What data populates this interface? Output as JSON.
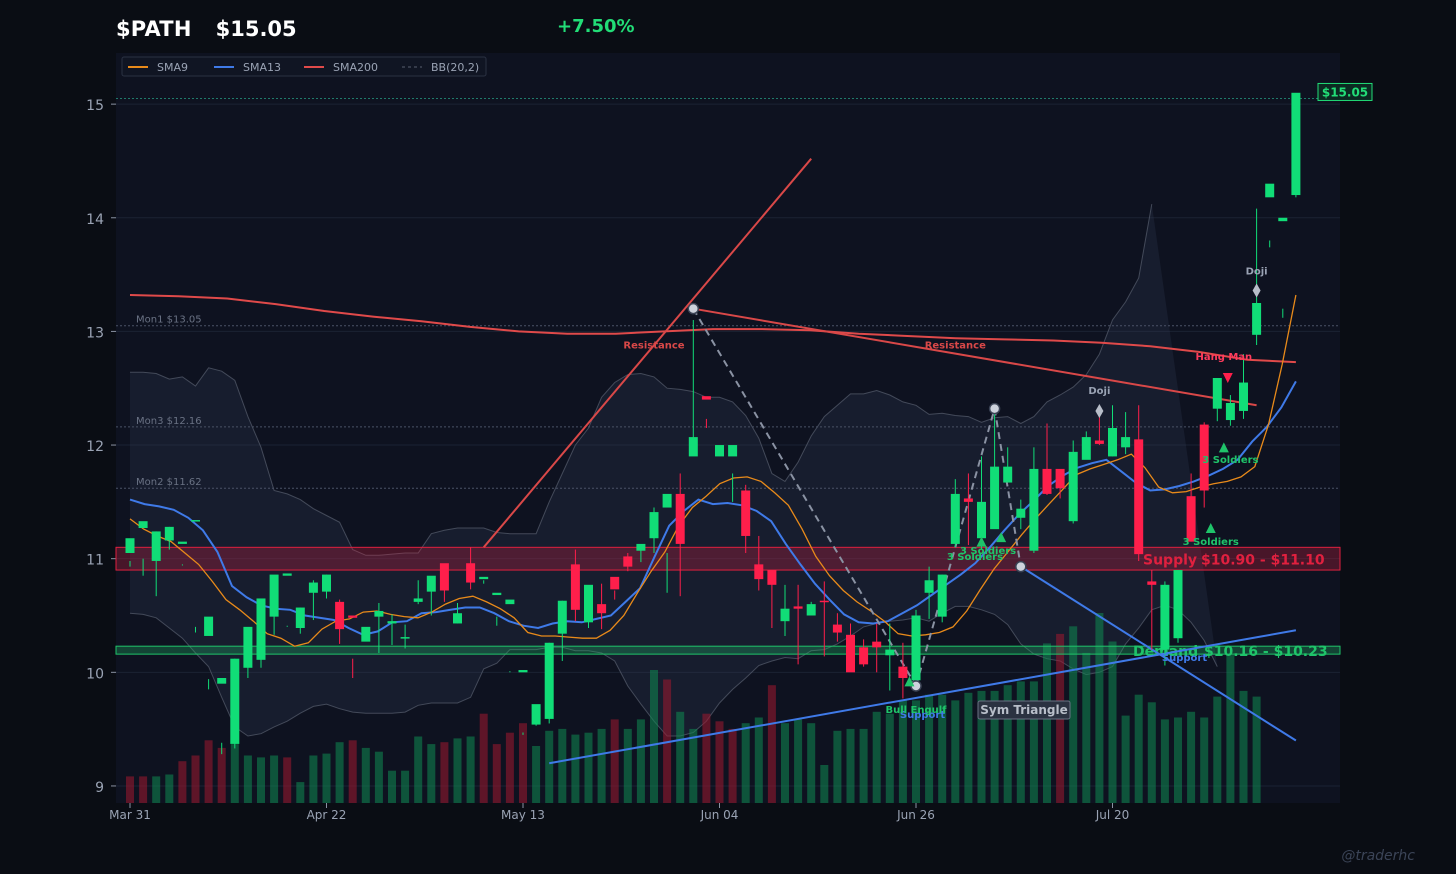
{
  "header": {
    "ticker": "$PATH",
    "price": "$15.05",
    "change": "+7.50%"
  },
  "watermark": "@traderhc",
  "colors": {
    "background": "#0a0d14",
    "plot_bg": "#0e1220",
    "up": "#11dd77",
    "down": "#ff1f4b",
    "sma9": "#e88a1a",
    "sma13": "#3f7ae8",
    "sma200": "#e04a4a",
    "bb": "#59606f",
    "supply": "#e0203f",
    "demand": "#1fc46a",
    "support_line": "#3f7ae8",
    "resistance_line": "#d94848"
  },
  "chart_data": {
    "type": "candlestick",
    "ylim": [
      8.85,
      15.45
    ],
    "yticks": [
      9,
      10,
      11,
      12,
      13,
      14,
      15
    ],
    "xticks": [
      {
        "label": "Mar 31",
        "index": 0
      },
      {
        "label": "Apr 22",
        "index": 15
      },
      {
        "label": "May 13",
        "index": 30
      },
      {
        "label": "Jun 04",
        "index": 45
      },
      {
        "label": "Jun 26",
        "index": 60
      },
      {
        "label": "Jul 20",
        "index": 75
      }
    ],
    "legend": [
      {
        "name": "SMA9",
        "color": "#e88a1a",
        "style": "solid"
      },
      {
        "name": "SMA13",
        "color": "#3f7ae8",
        "style": "solid"
      },
      {
        "name": "SMA200",
        "color": "#e04a4a",
        "style": "solid"
      },
      {
        "name": "BB(20,2)",
        "color": "#59606f",
        "style": "dashed"
      }
    ],
    "candles": [
      [
        11.05,
        11.18,
        10.93,
        10.98
      ],
      [
        11.27,
        11.33,
        10.85,
        11.0
      ],
      [
        10.98,
        11.24,
        10.67,
        11.24
      ],
      [
        11.16,
        11.28,
        11.08,
        11.28
      ],
      [
        11.13,
        11.15,
        10.94,
        10.95
      ],
      [
        11.33,
        11.34,
        10.35,
        10.4
      ],
      [
        10.32,
        10.49,
        9.85,
        9.94
      ],
      [
        9.9,
        9.95,
        9.28,
        9.38
      ],
      [
        9.37,
        10.12,
        9.33,
        10.12
      ],
      [
        10.04,
        10.4,
        9.95,
        10.31
      ],
      [
        10.11,
        10.65,
        10.04,
        10.62
      ],
      [
        10.49,
        10.86,
        10.33,
        10.76
      ],
      [
        10.85,
        10.87,
        10.4,
        10.41
      ],
      [
        10.39,
        10.57,
        10.34,
        10.57
      ],
      [
        10.7,
        10.79,
        10.46,
        10.81
      ],
      [
        10.71,
        10.86,
        10.65,
        10.86
      ],
      [
        10.62,
        10.38,
        10.25,
        10.64
      ],
      [
        10.5,
        10.48,
        9.95,
        10.12
      ],
      [
        10.27,
        10.4,
        10.29,
        10.37
      ],
      [
        10.49,
        10.54,
        10.17,
        10.61
      ],
      [
        10.43,
        10.45,
        10.24,
        10.51
      ],
      [
        10.3,
        10.31,
        10.21,
        10.42
      ],
      [
        10.62,
        10.65,
        10.6,
        10.81
      ],
      [
        10.71,
        10.85,
        10.5,
        10.84
      ],
      [
        10.96,
        10.72,
        10.62,
        10.89
      ],
      [
        10.43,
        10.52,
        10.43,
        10.61
      ],
      [
        10.96,
        10.79,
        10.73,
        11.1
      ],
      [
        10.82,
        10.84,
        10.81,
        10.78
      ],
      [
        10.68,
        10.7,
        10.41,
        10.49
      ],
      [
        10.6,
        10.64,
        10.0,
        10.01
      ],
      [
        10.0,
        10.02,
        9.45,
        9.47
      ],
      [
        9.54,
        9.72,
        9.53,
        9.68
      ],
      [
        9.59,
        10.26,
        9.55,
        10.26
      ],
      [
        10.34,
        10.63,
        10.1,
        10.63
      ],
      [
        10.95,
        10.55,
        10.45,
        11.08
      ],
      [
        10.44,
        10.77,
        10.39,
        10.76
      ],
      [
        10.6,
        10.52,
        10.38,
        10.78
      ],
      [
        10.84,
        10.73,
        10.64,
        10.72
      ],
      [
        11.02,
        10.93,
        10.89,
        11.05
      ],
      [
        11.07,
        11.13,
        10.97,
        11.12
      ],
      [
        11.18,
        11.41,
        11.05,
        11.45
      ],
      [
        11.45,
        11.57,
        11.05,
        10.7
      ],
      [
        11.57,
        11.13,
        10.67,
        11.75
      ],
      [
        11.9,
        12.07,
        11.97,
        13.1
      ],
      [
        12.43,
        12.4,
        12.23,
        12.15
      ],
      [
        11.9,
        12.0,
        11.6,
        11.6
      ],
      [
        11.9,
        12.0,
        11.5,
        11.75
      ],
      [
        11.6,
        11.2,
        11.05,
        11.65
      ],
      [
        10.95,
        10.82,
        10.72,
        11.2
      ],
      [
        10.9,
        10.77,
        10.39,
        10.85
      ],
      [
        10.45,
        10.56,
        10.32,
        10.77
      ],
      [
        10.58,
        10.56,
        10.07,
        10.77
      ],
      [
        10.5,
        10.6,
        10.5,
        10.62
      ],
      [
        10.63,
        10.62,
        10.14,
        10.8
      ],
      [
        10.42,
        10.35,
        10.27,
        10.52
      ],
      [
        10.33,
        10.0,
        10.03,
        10.43
      ],
      [
        10.22,
        10.07,
        10.05,
        10.29
      ],
      [
        10.27,
        10.22,
        10.0,
        10.43
      ],
      [
        10.15,
        10.2,
        9.84,
        10.43
      ],
      [
        10.05,
        9.95,
        9.77,
        10.26
      ],
      [
        9.93,
        10.5,
        9.87,
        10.55
      ],
      [
        10.7,
        10.81,
        10.47,
        10.93
      ],
      [
        10.49,
        10.86,
        10.44,
        10.86
      ],
      [
        11.13,
        11.57,
        11.1,
        11.7
      ],
      [
        11.53,
        11.5,
        11.12,
        11.75
      ],
      [
        11.18,
        11.5,
        11.08,
        11.9
      ],
      [
        11.26,
        11.81,
        11.38,
        12.3
      ],
      [
        11.67,
        11.81,
        11.78,
        11.98
      ],
      [
        11.36,
        11.44,
        11.26,
        11.52
      ],
      [
        11.07,
        11.79,
        11.05,
        11.98
      ],
      [
        11.79,
        11.57,
        11.56,
        12.19
      ],
      [
        11.79,
        11.62,
        11.53,
        11.77
      ],
      [
        11.33,
        11.94,
        11.31,
        12.04
      ],
      [
        11.87,
        12.07,
        11.97,
        12.12
      ],
      [
        12.04,
        12.01,
        12.0,
        12.34
      ],
      [
        11.9,
        12.15,
        11.9,
        12.35
      ],
      [
        11.98,
        12.07,
        11.92,
        12.29
      ],
      [
        12.05,
        11.04,
        10.98,
        12.35
      ],
      [
        10.8,
        10.77,
        10.2,
        10.9
      ],
      [
        10.2,
        10.77,
        10.06,
        10.8
      ],
      [
        10.3,
        10.9,
        10.26,
        10.9
      ],
      [
        11.55,
        11.15,
        11.15,
        11.75
      ],
      [
        12.18,
        11.6,
        11.45,
        12.2
      ],
      [
        12.32,
        12.59,
        12.21,
        12.42
      ],
      [
        12.22,
        12.37,
        12.17,
        12.44
      ],
      [
        12.3,
        12.55,
        12.23,
        12.8
      ],
      [
        12.97,
        13.25,
        12.88,
        14.08
      ],
      [
        14.18,
        14.3,
        13.8,
        13.74
      ],
      [
        13.97,
        14.0,
        13.2,
        13.12
      ],
      [
        14.2,
        15.1,
        14.18,
        15.05
      ]
    ],
    "overlays": {
      "sma9": [
        11.35,
        11.26,
        11.2,
        11.15,
        11.05,
        10.95,
        10.8,
        10.64,
        10.55,
        10.45,
        10.34,
        10.3,
        10.23,
        10.26,
        10.38,
        10.45,
        10.47,
        10.53,
        10.54,
        10.51,
        10.49,
        10.48,
        10.53,
        10.6,
        10.65,
        10.67,
        10.62,
        10.56,
        10.48,
        10.35,
        10.32,
        10.32,
        10.31,
        10.3,
        10.3,
        10.37,
        10.5,
        10.7,
        10.89,
        11.06,
        11.29,
        11.45,
        11.55,
        11.66,
        11.71,
        11.72,
        11.68,
        11.58,
        11.47,
        11.26,
        11.02,
        10.85,
        10.72,
        10.62,
        10.54,
        10.45,
        10.34,
        10.32,
        10.33,
        10.35,
        10.4,
        10.54,
        10.73,
        10.91,
        11.06,
        11.21,
        11.35,
        11.48,
        11.61,
        11.74,
        11.79,
        11.83,
        11.87,
        11.92,
        11.8,
        11.63,
        11.58,
        11.59,
        11.63,
        11.66,
        11.68,
        11.72,
        11.81,
        12.18,
        12.71,
        13.32
      ],
      "sma13": [
        11.52,
        11.48,
        11.46,
        11.43,
        11.36,
        11.25,
        11.06,
        10.76,
        10.66,
        10.59,
        10.56,
        10.55,
        10.5,
        10.48,
        10.46,
        10.39,
        10.33,
        10.36,
        10.44,
        10.45,
        10.52,
        10.53,
        10.55,
        10.57,
        10.57,
        10.52,
        10.45,
        10.41,
        10.39,
        10.43,
        10.45,
        10.44,
        10.47,
        10.5,
        10.62,
        10.74,
        11.02,
        11.29,
        11.42,
        11.52,
        11.48,
        11.49,
        11.47,
        11.42,
        11.33,
        11.13,
        10.95,
        10.78,
        10.64,
        10.51,
        10.44,
        10.43,
        10.45,
        10.52,
        10.59,
        10.68,
        10.77,
        10.86,
        10.96,
        11.1,
        11.25,
        11.39,
        11.51,
        11.64,
        11.73,
        11.8,
        11.84,
        11.87,
        11.77,
        11.67,
        11.6,
        11.61,
        11.64,
        11.68,
        11.73,
        11.79,
        11.87,
        12.03,
        12.16,
        12.33,
        12.56
      ],
      "sma200": [
        13.32,
        13.31,
        13.29,
        13.24,
        13.18,
        13.13,
        13.09,
        13.04,
        13.0,
        12.98,
        12.98,
        13.0,
        13.02,
        13.02,
        13.01,
        12.98,
        12.96,
        12.94,
        12.93,
        12.92,
        12.9,
        12.87,
        12.82,
        12.75,
        12.73
      ],
      "bb_upper": [
        12.64,
        12.64,
        12.63,
        12.58,
        12.6,
        12.52,
        12.68,
        12.65,
        12.57,
        12.25,
        11.98,
        11.6,
        11.57,
        11.52,
        11.44,
        11.38,
        11.32,
        11.08,
        11.03,
        11.03,
        11.04,
        11.05,
        11.05,
        11.22,
        11.25,
        11.27,
        11.27,
        11.27,
        11.23,
        11.22,
        11.22,
        11.22,
        11.5,
        11.75,
        12.0,
        12.15,
        12.42,
        12.55,
        12.62,
        12.63,
        12.6,
        12.5,
        12.49,
        12.47,
        12.42,
        12.42,
        12.38,
        12.26,
        12.06,
        11.75,
        11.68,
        11.85,
        12.08,
        12.25,
        12.35,
        12.45,
        12.45,
        12.48,
        12.44,
        12.38,
        12.35,
        12.27,
        12.28,
        12.26,
        12.25,
        12.2,
        12.24,
        12.25,
        12.19,
        12.25,
        12.38,
        12.44,
        12.51,
        12.62,
        12.8,
        13.1,
        13.26,
        13.47,
        14.12
      ],
      "bb_lower": [
        10.52,
        10.51,
        10.48,
        10.39,
        10.3,
        10.17,
        10.05,
        9.78,
        9.52,
        9.44,
        9.46,
        9.52,
        9.57,
        9.64,
        9.7,
        9.72,
        9.68,
        9.65,
        9.64,
        9.64,
        9.64,
        9.65,
        9.71,
        9.73,
        9.73,
        9.73,
        9.78,
        10.03,
        10.08,
        10.2,
        10.2,
        10.2,
        10.22,
        10.22,
        10.19,
        10.19,
        10.17,
        10.1,
        9.88,
        9.72,
        9.57,
        9.44,
        9.44,
        9.47,
        9.57,
        9.73,
        9.85,
        9.95,
        10.06,
        10.1,
        10.13,
        10.12,
        10.19,
        10.2,
        10.25,
        10.32,
        10.4,
        10.43,
        10.45,
        10.46,
        10.48,
        10.45,
        10.52,
        10.58,
        10.58,
        10.55,
        10.51,
        10.42,
        10.25,
        10.16,
        10.12,
        10.1,
        10.03,
        9.98,
        10.0,
        10.05,
        10.25,
        10.39,
        10.55,
        10.59,
        10.55,
        10.44,
        10.28,
        10.05
      ]
    },
    "volume": [
      0.14,
      0.14,
      0.14,
      0.15,
      0.22,
      0.25,
      0.33,
      0.29,
      0.31,
      0.25,
      0.24,
      0.25,
      0.24,
      0.11,
      0.25,
      0.26,
      0.32,
      0.33,
      0.29,
      0.27,
      0.17,
      0.17,
      0.35,
      0.31,
      0.32,
      0.34,
      0.35,
      0.47,
      0.31,
      0.37,
      0.42,
      0.3,
      0.38,
      0.39,
      0.36,
      0.37,
      0.39,
      0.44,
      0.39,
      0.44,
      0.7,
      0.65,
      0.48,
      0.39,
      0.47,
      0.43,
      0.39,
      0.42,
      0.45,
      0.62,
      0.42,
      0.44,
      0.42,
      0.2,
      0.38,
      0.39,
      0.39,
      0.48,
      0.47,
      0.54,
      0.54,
      0.57,
      0.57,
      0.54,
      0.58,
      0.59,
      0.59,
      0.62,
      0.64,
      0.64,
      0.84,
      0.89,
      0.93,
      0.79,
      1.0,
      0.85,
      0.46,
      0.57,
      0.53,
      0.44,
      0.45,
      0.48,
      0.45,
      0.56,
      0.78,
      0.59,
      0.56
    ],
    "horizontal_levels": [
      {
        "label": "Mon1 $13.05",
        "value": 13.05
      },
      {
        "label": "Mon3 $12.16",
        "value": 12.16
      },
      {
        "label": "Mon2 $11.62",
        "value": 11.62
      }
    ],
    "zones": [
      {
        "type": "supply",
        "title": "Supply",
        "range_text": "$10.90 - $11.10",
        "low": 10.9,
        "high": 11.1
      },
      {
        "type": "demand",
        "title": "Demand",
        "range_text": "$10.16 - $10.23",
        "low": 10.16,
        "high": 10.23
      }
    ],
    "trendlines": [
      {
        "name": "Resistance",
        "from": [
          27,
          11.1
        ],
        "to": [
          52,
          14.52
        ],
        "color": "resistance_line"
      },
      {
        "name": "Resistance",
        "from": [
          43,
          13.2
        ],
        "to": [
          86,
          12.35
        ],
        "color": "resistance_line"
      },
      {
        "name": "Support",
        "from": [
          32,
          9.2
        ],
        "to": [
          89,
          10.37
        ],
        "color": "support_line"
      },
      {
        "name": "Sym Triangle",
        "from": [
          68,
          10.93
        ],
        "to": [
          89,
          9.4
        ],
        "color": "support_line"
      }
    ],
    "pattern_labels": [
      {
        "text": "Resistance",
        "x": 40,
        "y": 12.85,
        "kind": "resistance"
      },
      {
        "text": "Resistance",
        "x": 63,
        "y": 12.85,
        "kind": "resistance"
      },
      {
        "text": "Support",
        "x": 60.5,
        "y": 9.6,
        "kind": "support"
      },
      {
        "text": "Support",
        "x": 80.5,
        "y": 10.1,
        "kind": "support"
      },
      {
        "text": "Bull Engulf",
        "x": 60,
        "y": 9.64,
        "kind": "bull"
      },
      {
        "text": "3 Soldiers",
        "x": 65.5,
        "y": 11.04,
        "kind": "bull"
      },
      {
        "text": "3 Soldiers",
        "x": 64.5,
        "y": 10.99,
        "kind": "bull"
      },
      {
        "text": "3 Soldiers",
        "x": 82.5,
        "y": 11.12,
        "kind": "bull"
      },
      {
        "text": "3 Soldiers",
        "x": 84,
        "y": 11.84,
        "kind": "bull"
      },
      {
        "text": "Doji",
        "x": 74,
        "y": 12.45,
        "kind": "doji"
      },
      {
        "text": "Doji",
        "x": 86,
        "y": 13.5,
        "kind": "doji"
      },
      {
        "text": "Hang Man",
        "x": 83.5,
        "y": 12.75,
        "kind": "bear"
      }
    ],
    "pattern_box": "Sym Triangle",
    "last_price_label": "$15.05",
    "last_price": 15.05
  }
}
